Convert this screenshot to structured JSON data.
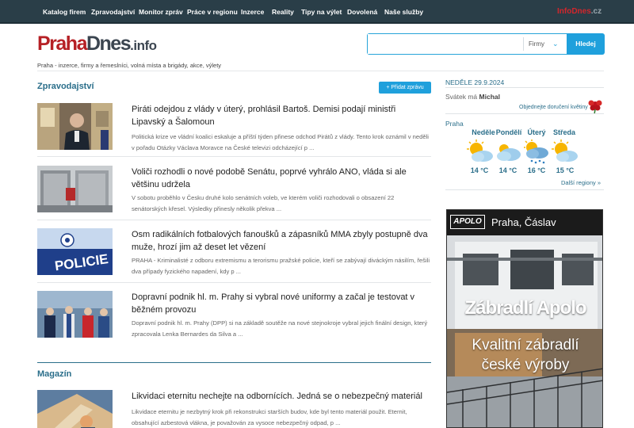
{
  "nav": {
    "items": [
      "Katalog firem",
      "Zpravodajství",
      "Monitor zpráv",
      "Práce v regionu",
      "Inzerce",
      "Reality",
      "Tipy na výlet",
      "Dovolená",
      "Naše služby"
    ],
    "brand_part1": "InfoDnes",
    "brand_part2": ".cz"
  },
  "header": {
    "logo_part1": "Praha",
    "logo_part2": "Dnes",
    "logo_part3": ".info",
    "tagline": "Praha - inzerce, firmy a řemeslníci, volná místa a brigády, akce, výlety"
  },
  "search": {
    "value": "",
    "placeholder": "",
    "category": "Firmy",
    "button": "Hledej"
  },
  "news": {
    "heading": "Zpravodajství",
    "add_button": "+ Přidat zprávu",
    "articles": [
      {
        "title": "Piráti odejdou z vlády v úterý, prohlásil Bartoš. Demisi podají ministři Lipavský a Šalomoun",
        "perex": "Politická krize ve vládní koalici eskaluje a příští týden přinese odchod Pirátů z vlády. Tento krok oznámil v neděli v pořadu Otázky Václava Moravce na České televizi odcházející p ..."
      },
      {
        "title": "Voliči rozhodli o nové podobě Senátu, poprvé vyhrálo ANO, vláda si ale většinu udržela",
        "perex": "V sobotu proběhlo v Česku druhé kolo senátních voleb, ve kterém voliči rozhodovali o obsazení 22 senátorských křesel. Výsledky přinesly několik překva ..."
      },
      {
        "title": "Osm radikálních fotbalových fanoušků a zápasníků MMA zbyly postupně dva muže, hrozí jim až deset let vězení",
        "perex": "PRAHA - Kriminalisté z odboru extremismu a terorismu pražské policie, kteří se zabývají diváckým násilím, řešili dva případy fyzického napadení, kdy p ..."
      },
      {
        "title": "Dopravní podnik hl. m. Prahy si vybral nové uniformy a začal je testovat v běžném provozu",
        "perex": "Dopravní podnik hl. m. Prahy (DPP) si na základě soutěže na nové stejnokroje vybral jejich finální design, který zpracovala Lenka Bernardes da Silva a ..."
      }
    ],
    "police_label": "POLICIE"
  },
  "magazine": {
    "heading": "Magazín",
    "articles": [
      {
        "title": "Likvidaci eternitu nechejte na odbornících. Jedná se o nebezpečný materiál",
        "perex": "Likvidace eternitu je nezbytný krok při rekonstrukci starších budov, kde byl tento materiál použit. Eternit, obsahující azbestová vlákna, je považován za vysoce nebezpečný odpad, p ..."
      }
    ]
  },
  "sidebar": {
    "date": "NEDĚLE 29.9.2024",
    "nameday_prefix": "Svátek má",
    "nameday_name": "Michal",
    "flowers_link": "Objednejte doručení květiny",
    "city": "Praha",
    "weather": [
      {
        "day": "Neděle",
        "temp": "14 °C",
        "icon": "sun-cloud-icon"
      },
      {
        "day": "Pondělí",
        "temp": "14 °C",
        "icon": "cloud-icon"
      },
      {
        "day": "Úterý",
        "temp": "16 °C",
        "icon": "sun-rain-icon"
      },
      {
        "day": "Středa",
        "temp": "15 °C",
        "icon": "sun-cloud-icon"
      }
    ],
    "other_regions": "Další regiony »"
  },
  "ad": {
    "logo": "APOLO",
    "city": "Praha, Čáslav",
    "title": "Zábradlí Apolo",
    "subtitle1": "Kvalitní zábradlí",
    "subtitle2": "české výroby"
  },
  "colors": {
    "nav_bg": "#2a3e48",
    "accent": "#1fa0dc",
    "heading": "#2a6e8a",
    "logo_red": "#b62025"
  }
}
